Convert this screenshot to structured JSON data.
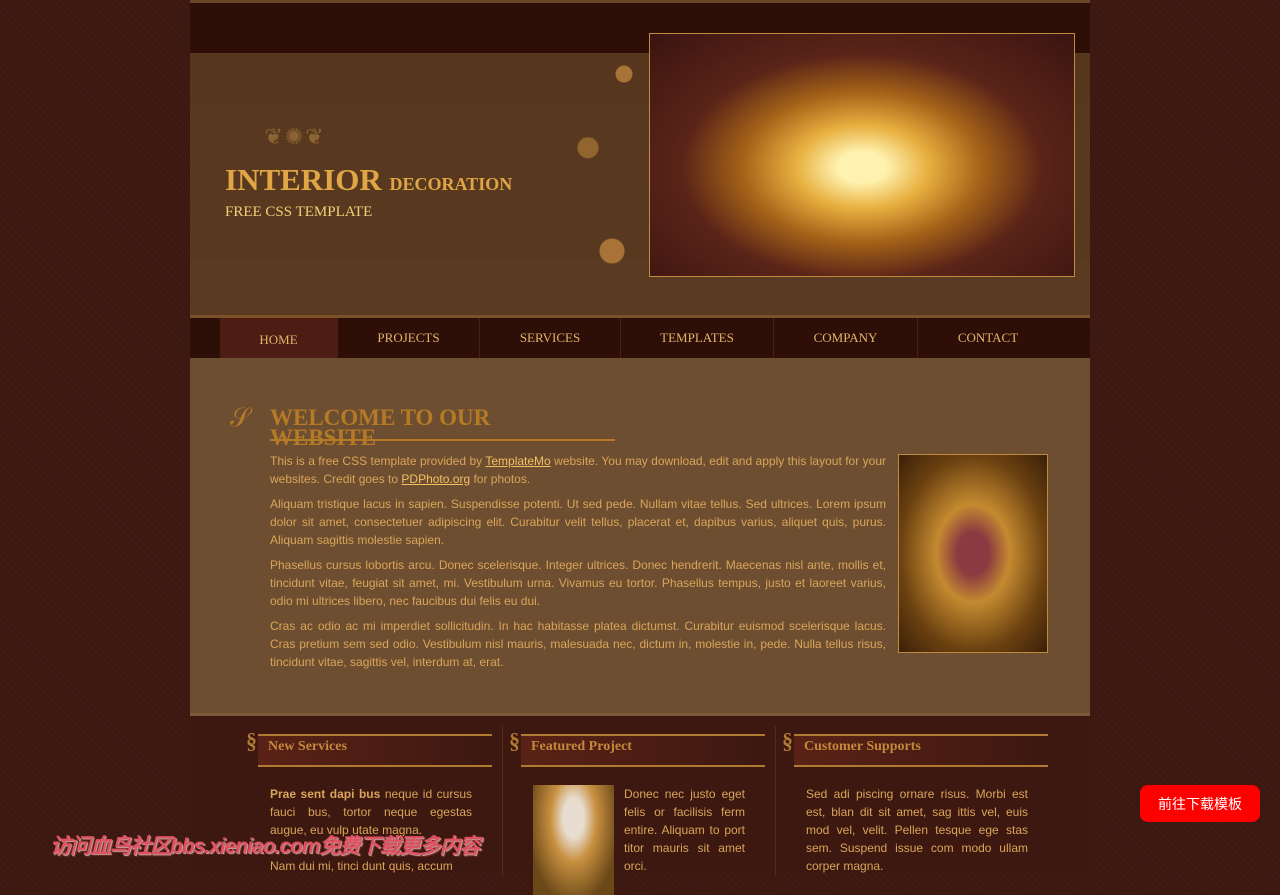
{
  "header": {
    "logo_main": "INTERIOR",
    "logo_sub": "DECORATION",
    "tagline": "FREE CSS TEMPLATE"
  },
  "nav": [
    {
      "label": "HOME",
      "active": true
    },
    {
      "label": "PROJECTS"
    },
    {
      "label": "SERVICES"
    },
    {
      "label": "TEMPLATES"
    },
    {
      "label": "COMPANY"
    },
    {
      "label": "CONTACT"
    }
  ],
  "main": {
    "title": "WELCOME TO OUR WEBSITE",
    "p1_a": "This is a free CSS template provided by ",
    "link1": "TemplateMo",
    "p1_b": " website. You may download, edit and apply this layout for your websites. Credit goes to ",
    "link2": "PDPhoto.org",
    "p1_c": " for photos.",
    "p2": "Aliquam tristique lacus in sapien. Suspendisse potenti. Ut sed pede. Nullam vitae tellus. Sed ultrices. Lorem ipsum dolor sit amet, consectetuer adipiscing elit. Curabitur velit tellus, placerat et, dapibus varius, aliquet quis, purus. Aliquam sagittis molestie sapien.",
    "p3": "Phasellus cursus lobortis arcu. Donec scelerisque. Integer ultrices. Donec hendrerit. Maecenas nisl ante, mollis et, tincidunt vitae, feugiat sit amet, mi. Vestibulum urna. Vivamus eu tortor. Phasellus tempus, justo et laoreet varius, odio mi ultrices libero, nec faucibus dui felis eu dui.",
    "p4": "Cras ac odio ac mi imperdiet sollicitudin. In hac habitasse platea dictumst. Curabitur euismod scelerisque lacus. Cras pretium sem sed odio. Vestibulum nisl mauris, malesuada nec, dictum in, molestie in, pede. Nulla tellus risus, tincidunt vitae, sagittis vel, interdum at, erat."
  },
  "footer": {
    "services": {
      "title": "New Services",
      "bold": "Prae sent dapi bus",
      "text": " neque id cursus fauci bus, tortor neque egestas augue, eu vulp utate magna.",
      "text2": "Nam dui mi, tinci dunt quis, accum"
    },
    "featured": {
      "title": "Featured Project",
      "text": "Donec nec justo eget felis or facilisis ferm entire. Aliquam to port titor mauris sit amet orci."
    },
    "support": {
      "title": "Customer Supports",
      "text": "Sed adi piscing ornare risus. Morbi est est, blan dit sit amet, sag ittis vel, euis mod vel, velit. Pellen tesque ege stas sem. Suspend issue com modo ullam corper magna."
    }
  },
  "watermark": "访问血鸟社区bbs.xieniao.com免费下载更多内容",
  "download_button": "前往下载模板",
  "colors": {
    "accent": "#d9a559",
    "nav_bg": "#2e0f07",
    "download": "#ff0000"
  }
}
